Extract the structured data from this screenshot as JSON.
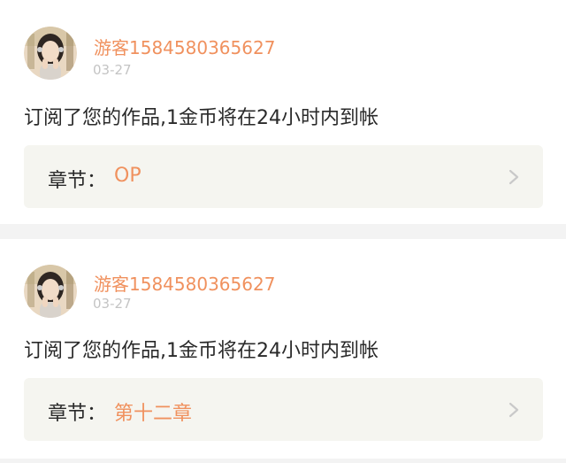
{
  "notifications": [
    {
      "username": "游客1584580365627",
      "date": "03-27",
      "message": "订阅了您的作品,1金币将在24小时内到帐",
      "chapter_label": "章节：",
      "chapter_name": "OP",
      "avatar_icon": "user-avatar-icon",
      "chevron_icon": "chevron-right-icon"
    },
    {
      "username": "游客1584580365627",
      "date": "03-27",
      "message": "订阅了您的作品,1金币将在24小时内到帐",
      "chapter_label": "章节：",
      "chapter_name": "第十二章",
      "avatar_icon": "user-avatar-icon",
      "chevron_icon": "chevron-right-icon"
    }
  ],
  "colors": {
    "accent": "#f0915e",
    "page_background": "#f3f3f3",
    "card_background": "#ffffff",
    "chapter_row_background": "#f5f5f0",
    "date_text": "#c4c4c4",
    "body_text": "#2a2a2a"
  }
}
